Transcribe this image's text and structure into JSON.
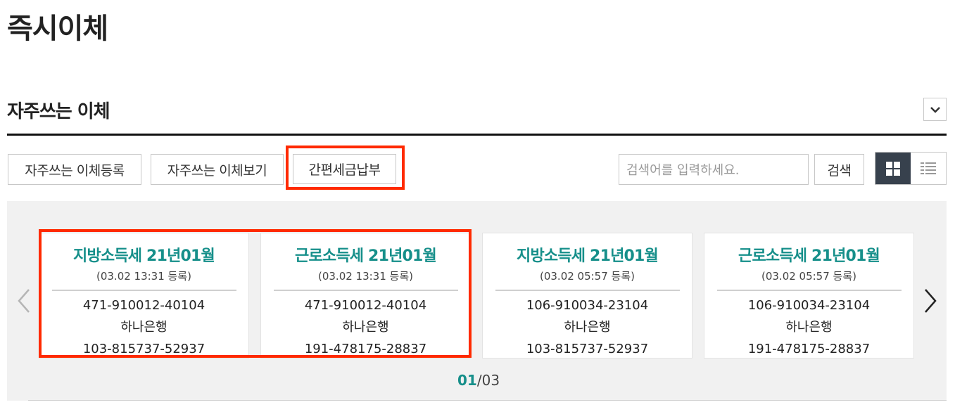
{
  "page": {
    "title": "즉시이체"
  },
  "section": {
    "title": "자주쓰는 이체"
  },
  "toolbar": {
    "register_label": "자주쓰는 이체등록",
    "view_label": "자주쓰는 이체보기",
    "tax_label": "간편세금납부",
    "search_placeholder": "검색어를 입력하세요.",
    "search_label": "검색"
  },
  "view_mode": {
    "selected": "grid"
  },
  "cards": [
    {
      "title": "지방소득세 21년01월",
      "date": "(03.02 13:31 등록)",
      "line1": "471-910012-40104",
      "bank": "하나은행",
      "account": "103-815737-52937"
    },
    {
      "title": "근로소득세 21년01월",
      "date": "(03.02 13:31 등록)",
      "line1": "471-910012-40104",
      "bank": "하나은행",
      "account": "191-478175-28837"
    },
    {
      "title": "지방소득세 21년01월",
      "date": "(03.02 05:57 등록)",
      "line1": "106-910034-23104",
      "bank": "하나은행",
      "account": "103-815737-52937"
    },
    {
      "title": "근로소득세 21년01월",
      "date": "(03.02 05:57 등록)",
      "line1": "106-910034-23104",
      "bank": "하나은행",
      "account": "191-478175-28837"
    }
  ],
  "pager": {
    "current": "01",
    "separator": "/",
    "total": "03"
  },
  "colors": {
    "accent": "#168f8a",
    "highlight": "#ff2a00",
    "toggle_active": "#37414d"
  }
}
